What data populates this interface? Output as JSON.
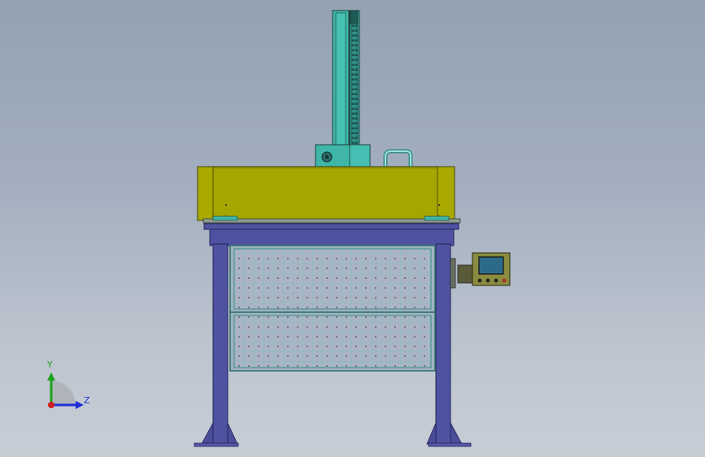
{
  "triad": {
    "y_label": "Y",
    "z_label": "Z"
  },
  "colors": {
    "background_top": "#93a1b3",
    "background_bottom": "#c8ced6",
    "frame": "#4f52a0",
    "enclosure": "#a6a600",
    "column": "#3fb6a8",
    "panel_mesh": "#9fd8cf",
    "control_box": "#8a8c40",
    "screen": "#2d6a8a",
    "axis_y": "#1ea01e",
    "axis_z": "#1f2fd6"
  }
}
